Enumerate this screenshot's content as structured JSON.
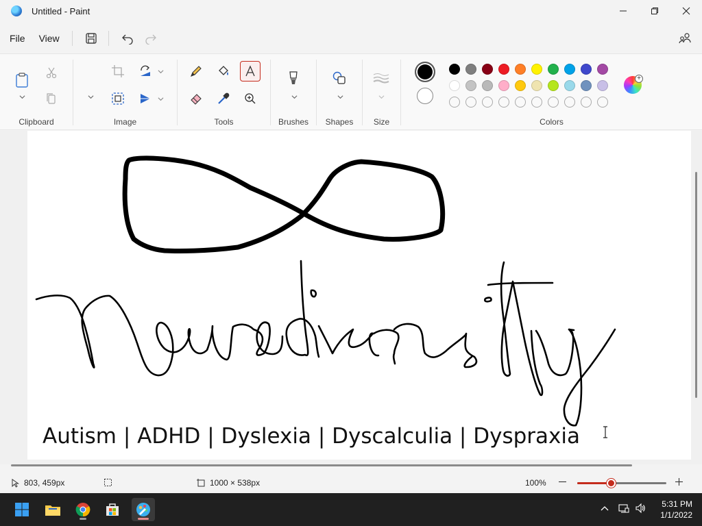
{
  "window": {
    "title": "Untitled - Paint"
  },
  "menu": {
    "file": "File",
    "view": "View"
  },
  "ribbon": {
    "groups": {
      "clipboard": "Clipboard",
      "image": "Image",
      "tools": "Tools",
      "brushes": "Brushes",
      "shapes": "Shapes",
      "size": "Size",
      "colors": "Colors"
    },
    "selected_tool": "text-tool",
    "primary_color": "#000000",
    "secondary_color": "#ffffff",
    "palette_row1": [
      "#000000",
      "#7f7f7f",
      "#880015",
      "#ed1c24",
      "#ff7f27",
      "#fff200",
      "#22b14c",
      "#00a2e8",
      "#3f48cc",
      "#a349a4"
    ],
    "palette_row2": [
      "#ffffff",
      "#c3c3c3",
      "#b9b9b9",
      "#ffaec9",
      "#ffc90e",
      "#efe4b0",
      "#b5e61d",
      "#99d9ea",
      "#7092be",
      "#c8bfe7"
    ],
    "palette_row3_empty_count": 10
  },
  "canvas": {
    "caption": "Autism | ADHD | Dyslexia | Dyscalculia | Dyspraxia",
    "drawing": "infinity symbol and handwritten word Neurodiversity"
  },
  "status": {
    "cursor_pos": "803, 459px",
    "canvas_size": "1000 × 538px",
    "zoom": "100%",
    "zoom_level_fraction": 0.38
  },
  "taskbar": {
    "apps": [
      "start-icon",
      "file-explorer-icon",
      "chrome-icon",
      "microsoft-store-icon",
      "paint-icon"
    ],
    "time": "5:31 PM",
    "date": "1/1/2022"
  }
}
